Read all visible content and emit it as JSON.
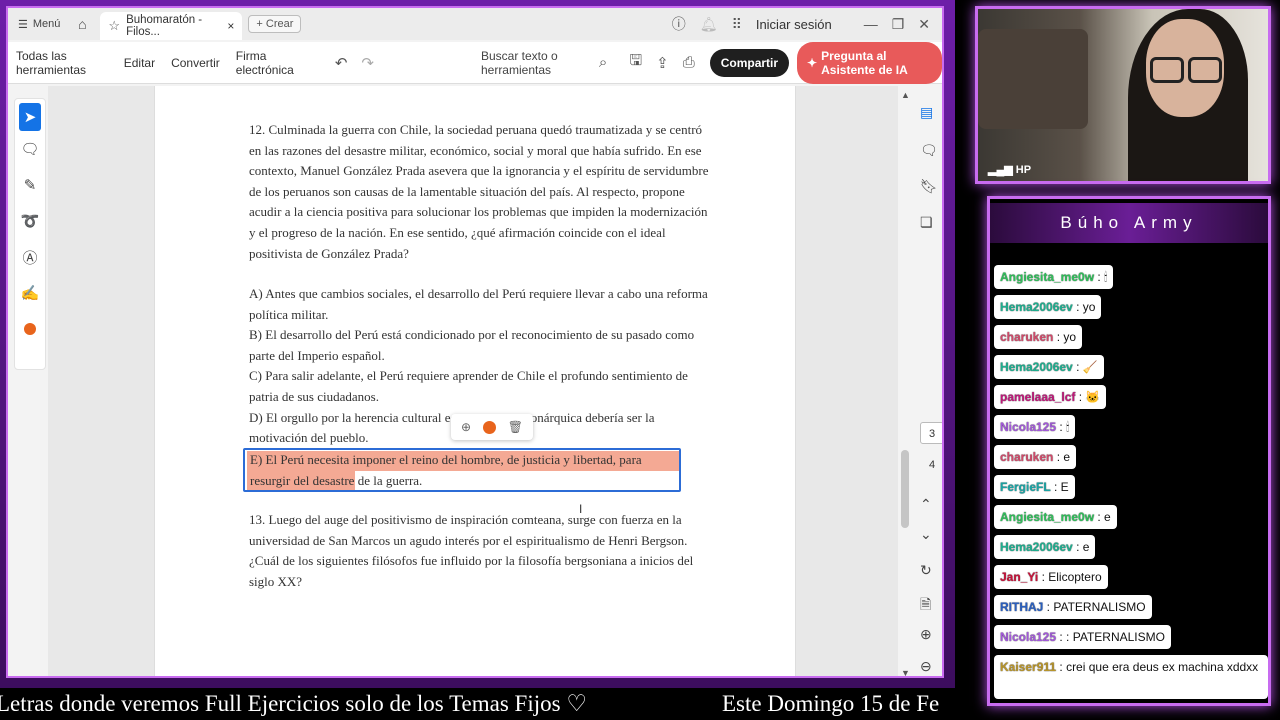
{
  "browser": {
    "menu_label": "Menú",
    "tab_title": "Buhomaratón - Filos...",
    "tab_close": "×",
    "new_tab_label": "+ Crear",
    "login_label": "Iniciar sesión"
  },
  "toolbar": {
    "items": [
      "Todas las herramientas",
      "Editar",
      "Convertir",
      "Firma electrónica"
    ],
    "search_label": "Buscar texto o herramientas",
    "share_label": "Compartir",
    "ai_label": "Pregunta al Asistente de IA"
  },
  "document": {
    "q12": "12. Culminada la guerra con Chile, la sociedad peruana quedó traumatizada y se centró en las razones del desastre militar, económico, social y moral que había sufrido. En ese contexto, Manuel González Prada asevera que la ignorancia y el espíritu de servidumbre de los peruanos son causas de la lamentable situación del país. Al respecto, propone acudir a la ciencia positiva para solucionar los problemas que impiden la modernización y el progreso de la nación. En ese sentido, ¿qué afirmación coincide con el ideal positivista de González Prada?",
    "optA": "A) Antes que cambios sociales, el desarrollo del Perú requiere llevar a cabo una reforma política militar.",
    "optB": "B) El desarrollo del Perú está condicionado por el reconocimiento de su pasado como parte del Imperio español.",
    "optC": "C) Para salir adelante, el Perú requiere aprender de Chile el profundo sentimiento de patria de sus ciudadanos.",
    "optD": "D) El orgullo por la herencia cultural esp                  monárquica debería ser la motivación del pueblo.",
    "optE": "E) El Perú necesita imponer el reino del hombre, de justicia y libertad, para resurgir del desastre de la guerra.",
    "q13": "13. Luego del auge del positivismo de inspiración comteana, surge con fuerza en la universidad de San Marcos un agudo interés por el espiritualismo de Henri Bergson. ¿Cuál de los siguientes filósofos fue influido por la filosofía bergsoniana a inicios del siglo XX?"
  },
  "pagination": {
    "current": "3",
    "next": "4"
  },
  "stream": {
    "camera_label": "HP",
    "chat_title": "Búho Army",
    "ticker_left": "Letras donde veremos Full Ejercicios solo de los Temas Fijos ♡",
    "ticker_right": "Este Domingo 15 de Fe"
  },
  "chat": [
    {
      "user": "Angiesita_me0w",
      "text": ": 🕯",
      "color": "#2fbf5a"
    },
    {
      "user": "Hema2006ev",
      "text": ": yo",
      "color": "#1fae8f"
    },
    {
      "user": "charuken",
      "text": ": yo",
      "color": "#d04a6a"
    },
    {
      "user": "Hema2006ev",
      "text": ": 🧹",
      "color": "#1fae8f"
    },
    {
      "user": "pamelaaa_lcf",
      "text": ": 🐱",
      "color": "#c0187a"
    },
    {
      "user": "Nicola125",
      "text": ": 🕯",
      "color": "#a259d9"
    },
    {
      "user": "charuken",
      "text": ": e",
      "color": "#d04a6a"
    },
    {
      "user": "FergieFL",
      "text": ": E",
      "color": "#1aa5a5"
    },
    {
      "user": "Angiesita_me0w",
      "text": ": e",
      "color": "#2fbf5a"
    },
    {
      "user": "Hema2006ev",
      "text": ": e",
      "color": "#1fae8f"
    },
    {
      "user": "Jan_Yi",
      "text": ": Elicoptero",
      "color": "#c8123a"
    },
    {
      "user": "RITHAJ",
      "text": ": PATERNALISMO",
      "color": "#2a5fbf"
    },
    {
      "user": "Nicola125",
      "text": ": : PATERNALISMO",
      "color": "#a259d9"
    },
    {
      "user": "Kaiser911",
      "text": ": crei que era deus ex machina xddxx",
      "color": "#b8952a"
    }
  ]
}
